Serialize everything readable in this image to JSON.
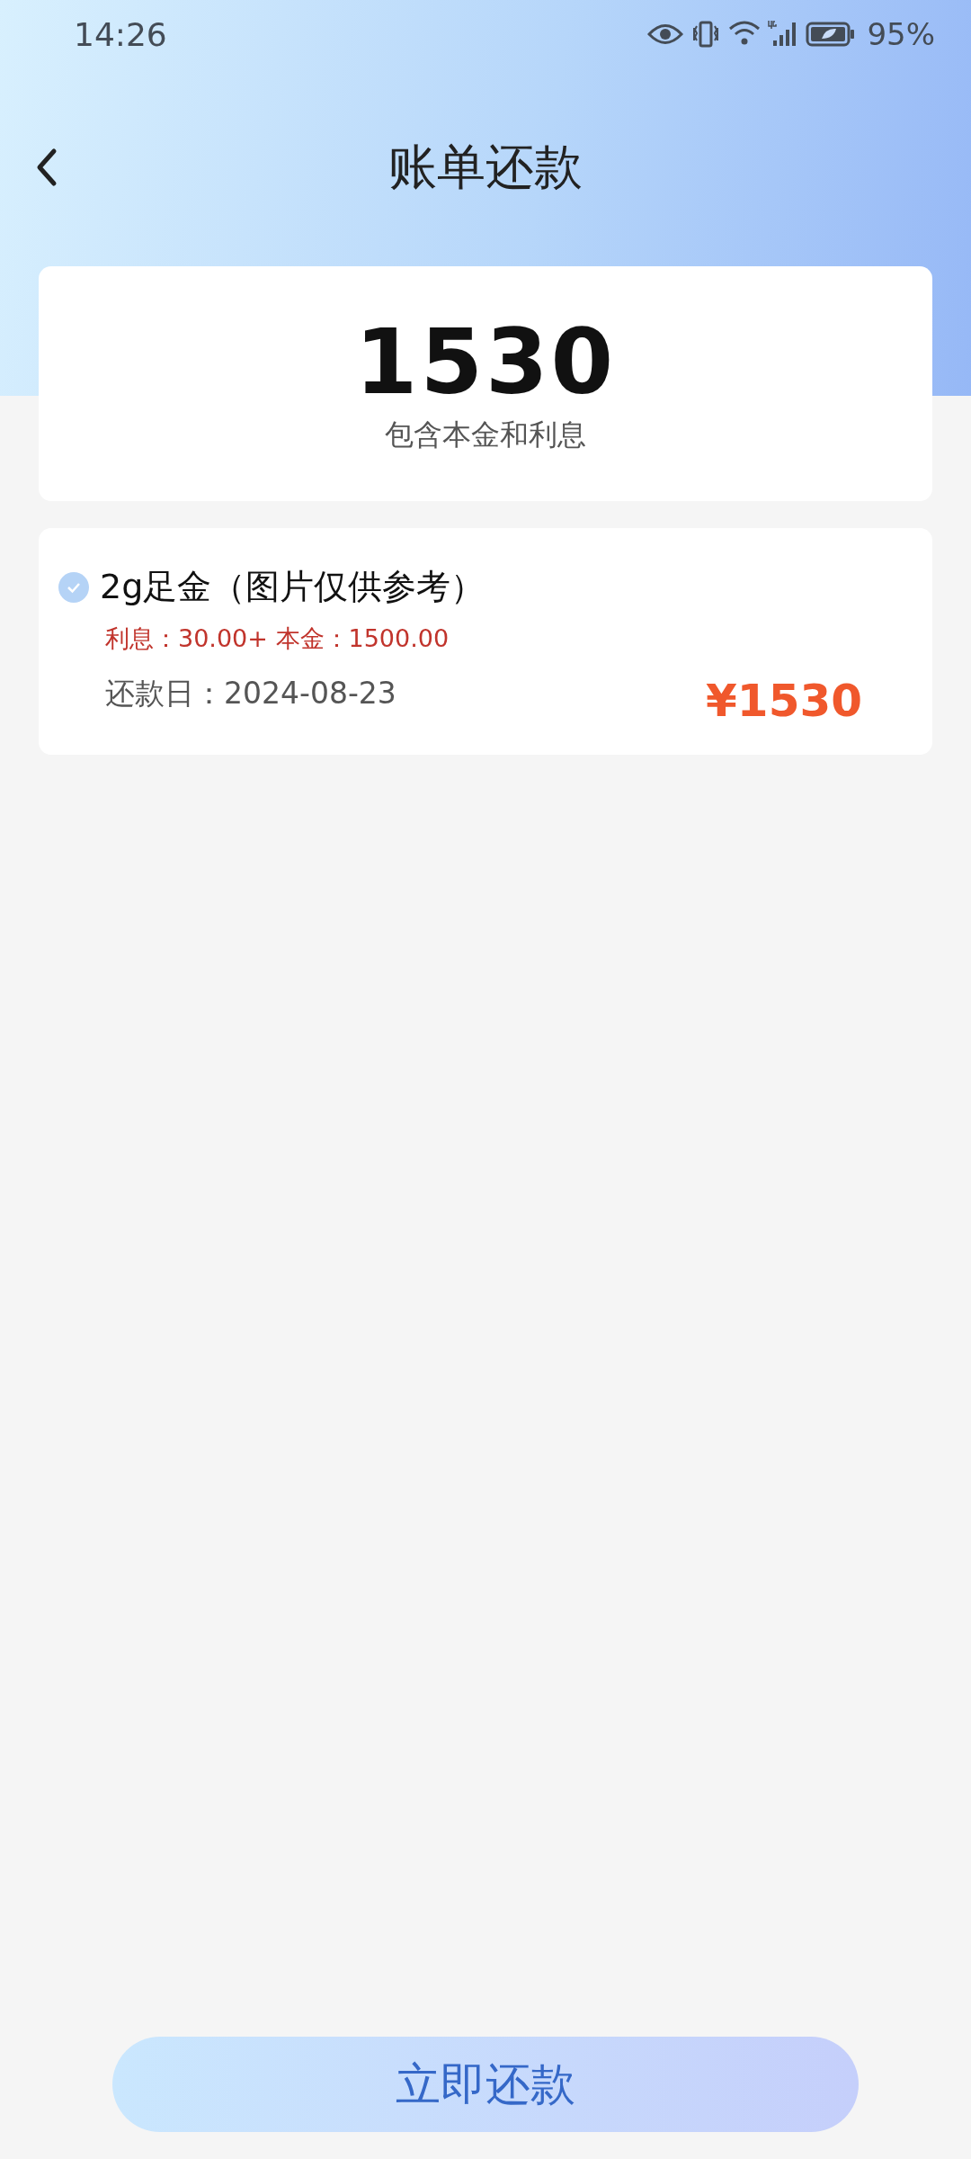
{
  "status_bar": {
    "time": "14:26",
    "battery": "95%"
  },
  "header": {
    "title": "账单还款"
  },
  "summary": {
    "amount": "1530",
    "caption": "包含本金和利息"
  },
  "items": [
    {
      "name": "2g足金（图片仅供参考）",
      "checked": true,
      "breakdown": "利息：30.00+ 本金：1500.00",
      "due_date": "还款日：2024-08-23",
      "amount": "¥1530"
    }
  ],
  "pay_button": "立即还款"
}
